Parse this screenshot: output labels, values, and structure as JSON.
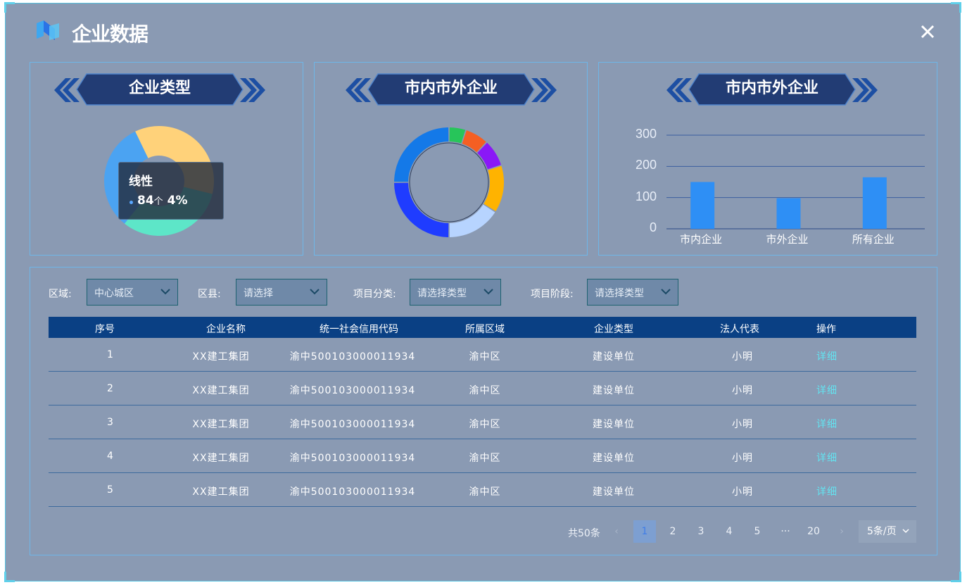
{
  "header": {
    "title": "企业数据",
    "close_icon": "close-icon"
  },
  "panels": {
    "type": {
      "title": "企业类型"
    },
    "ring": {
      "title": "市内市外企业"
    },
    "bar": {
      "title": "市内市外企业"
    }
  },
  "tooltip": {
    "name": "线性",
    "value": "84",
    "unit": "个",
    "percent": "4%"
  },
  "donut_type": {
    "colors": [
      "#ffd27a",
      "#5de6c8",
      "#4ba3f2"
    ],
    "values": [
      36,
      32,
      32
    ]
  },
  "ring_chart": {
    "colors": [
      "#27c55a",
      "#f45f23",
      "#8a18f7",
      "#ffb300",
      "#b7d4ff",
      "#1f3cff",
      "#1479e8"
    ],
    "values": [
      5,
      7,
      8,
      14,
      16,
      25,
      25
    ]
  },
  "chart_data": {
    "type": "bar",
    "categories": [
      "市内企业",
      "市外企业",
      "所有企业"
    ],
    "values": [
      150,
      98,
      165
    ],
    "ylim": [
      0,
      300
    ],
    "yticks": [
      "0",
      "100",
      "200",
      "300"
    ],
    "bar_color": "#2e8ff5",
    "grid": true
  },
  "filters": {
    "region_label": "区域:",
    "region_value": "中心城区",
    "county_label": "区县:",
    "county_placeholder": "请选择",
    "category_label": "项目分类:",
    "category_placeholder": "请选择类型",
    "stage_label": "项目阶段:",
    "stage_placeholder": "请选择类型"
  },
  "table": {
    "headers": [
      "序号",
      "企业名称",
      "统一社会信用代码",
      "所属区域",
      "企业类型",
      "法人代表",
      "操作"
    ],
    "rows": [
      [
        "1",
        "XX建工集团",
        "渝中500103000011934",
        "渝中区",
        "建设单位",
        "小明",
        "详细"
      ],
      [
        "2",
        "XX建工集团",
        "渝中500103000011934",
        "渝中区",
        "建设单位",
        "小明",
        "详细"
      ],
      [
        "3",
        "XX建工集团",
        "渝中500103000011934",
        "渝中区",
        "建设单位",
        "小明",
        "详细"
      ],
      [
        "4",
        "XX建工集团",
        "渝中500103000011934",
        "渝中区",
        "建设单位",
        "小明",
        "详细"
      ],
      [
        "5",
        "XX建工集团",
        "渝中500103000011934",
        "渝中区",
        "建设单位",
        "小明",
        "详细"
      ]
    ]
  },
  "pagination": {
    "total": "共50条",
    "prev": "‹",
    "pages": [
      "1",
      "2",
      "3",
      "4",
      "5",
      "···",
      "20"
    ],
    "next": "›",
    "current": "1",
    "page_size": "5条/页"
  }
}
